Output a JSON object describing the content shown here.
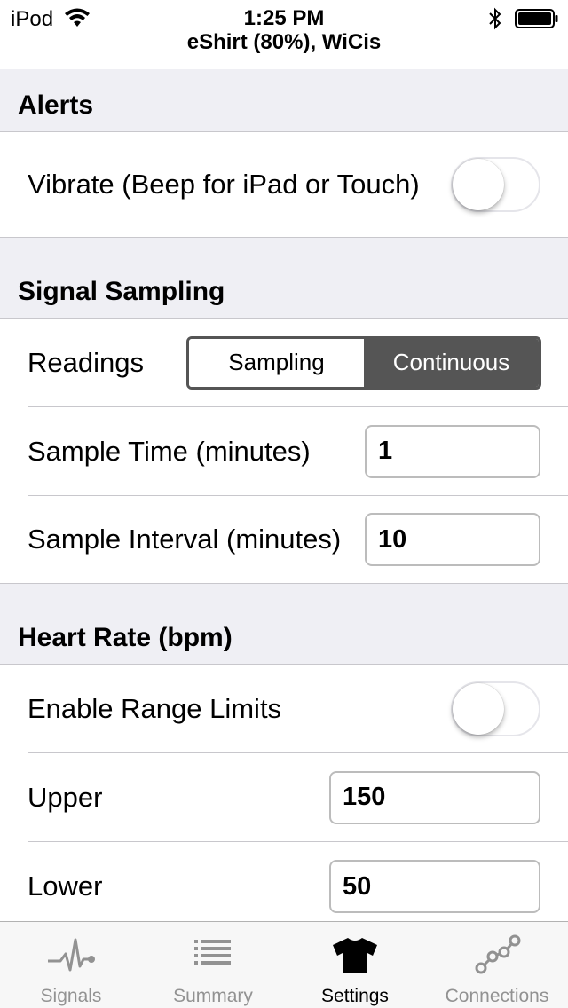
{
  "status_bar": {
    "carrier": "iPod",
    "time": "1:25 PM",
    "subtitle": "eShirt (80%), WiCis",
    "wifi_icon": "wifi-icon",
    "bluetooth_icon": "bluetooth-icon",
    "battery_icon": "battery-icon"
  },
  "alerts": {
    "header": "Alerts",
    "vibrate_label": "Vibrate (Beep for iPad or Touch)",
    "vibrate_on": false
  },
  "signal_sampling": {
    "header": "Signal Sampling",
    "readings_label": "Readings",
    "segments": [
      "Sampling",
      "Continuous"
    ],
    "selected_segment": "Continuous",
    "sample_time_label": "Sample Time (minutes)",
    "sample_time_value": "1",
    "sample_interval_label": "Sample Interval (minutes)",
    "sample_interval_value": "10"
  },
  "heart_rate": {
    "header": "Heart Rate (bpm)",
    "enable_label": "Enable Range Limits",
    "enable_on": false,
    "upper_label": "Upper",
    "upper_value": "150",
    "lower_label": "Lower",
    "lower_value": "50"
  },
  "tab_bar": {
    "tabs": [
      {
        "label": "Signals",
        "icon": "heartbeat-icon"
      },
      {
        "label": "Summary",
        "icon": "list-icon"
      },
      {
        "label": "Settings",
        "icon": "tshirt-icon"
      },
      {
        "label": "Connections",
        "icon": "connections-icon"
      }
    ],
    "active": "Settings"
  },
  "colors": {
    "section_bg": "#efeff4",
    "segment_selected": "#555555",
    "tab_inactive": "#929292",
    "separator": "#c8c7cc"
  }
}
